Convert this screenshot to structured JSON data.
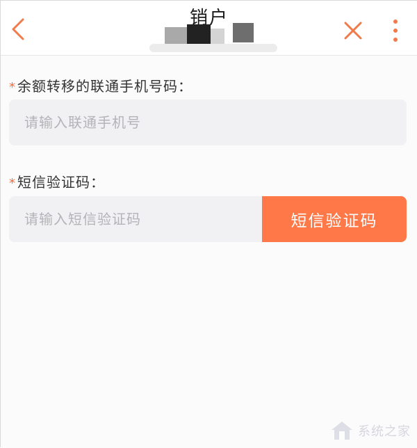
{
  "header": {
    "title": "销户"
  },
  "form": {
    "phone_label": "余额转移的联通手机号码：",
    "phone_placeholder": "请输入联通手机号",
    "sms_label": "短信验证码：",
    "sms_placeholder": "请输入短信验证码",
    "sms_button_label": "短信验证码",
    "required_mark": "*"
  },
  "colors": {
    "accent": "#ff7847",
    "icon_accent": "#f07a4a",
    "input_bg": "#f1f0f2"
  },
  "icons": {
    "back": "chevron-left-icon",
    "close": "close-icon",
    "more": "more-vertical-icon"
  },
  "watermark": {
    "text": "系统之家"
  }
}
